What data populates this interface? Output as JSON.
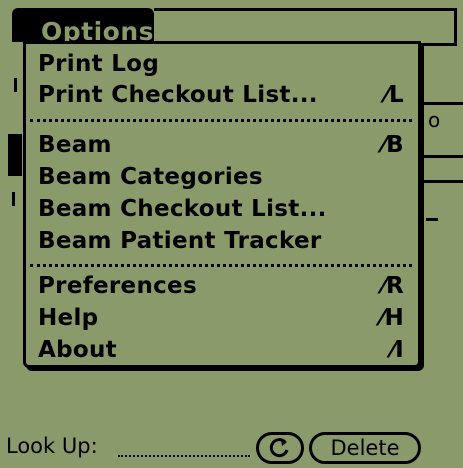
{
  "menu": {
    "title": "Options",
    "groups": [
      [
        {
          "label": "Print Log",
          "shortcut": ""
        },
        {
          "label": "Print Checkout List...",
          "shortcut": "⁄L"
        }
      ],
      [
        {
          "label": "Beam",
          "shortcut": "⁄B"
        },
        {
          "label": "Beam Categories",
          "shortcut": ""
        },
        {
          "label": "Beam Checkout List...",
          "shortcut": ""
        },
        {
          "label": "Beam Patient Tracker",
          "shortcut": ""
        }
      ],
      [
        {
          "label": "Preferences",
          "shortcut": "⁄R"
        },
        {
          "label": "Help",
          "shortcut": "⁄H"
        },
        {
          "label": "About",
          "shortcut": "⁄I"
        }
      ]
    ]
  },
  "bottom": {
    "lookup_label": "Look Up:",
    "refresh_icon": "refresh-icon",
    "delete_label": "Delete"
  },
  "background": {
    "fragment": "o"
  },
  "colors": {
    "screen": "#8a9a6b",
    "ink": "#000000"
  }
}
